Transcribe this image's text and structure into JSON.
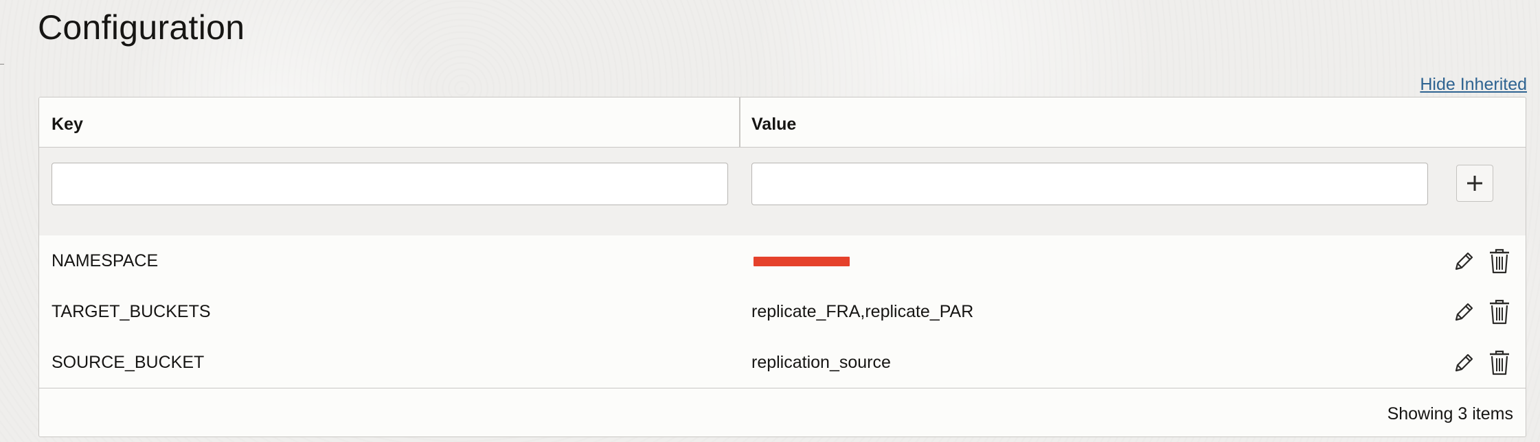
{
  "page": {
    "title": "Configuration",
    "hide_inherited_label": "Hide Inherited"
  },
  "table": {
    "columns": [
      {
        "label": "Key"
      },
      {
        "label": "Value"
      }
    ],
    "new_row": {
      "key_value": "",
      "value_value": "",
      "add_icon": "plus-icon"
    },
    "rows": [
      {
        "key": "NAMESPACE",
        "value": "",
        "value_redacted": true
      },
      {
        "key": "TARGET_BUCKETS",
        "value": "replicate_FRA,replicate_PAR",
        "value_redacted": false
      },
      {
        "key": "SOURCE_BUCKET",
        "value": "replication_source",
        "value_redacted": false
      }
    ],
    "row_actions": [
      "pencil-icon",
      "trash-icon"
    ],
    "footer": "Showing 3 items"
  },
  "colors": {
    "link": "#2e6391",
    "redaction": "#e5412b",
    "text": "#161513",
    "border": "#c9c7c4"
  }
}
